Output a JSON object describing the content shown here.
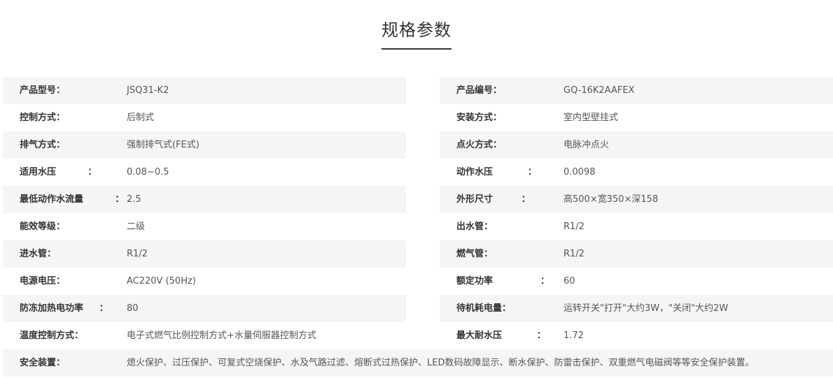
{
  "page": {
    "title": "规格参数"
  },
  "rows": [
    {
      "left": {
        "label": "产品型号：",
        "value": "JSQ31-K2"
      },
      "right": {
        "label": "产品编号：",
        "value": "GQ-16K2AAFEX"
      }
    },
    {
      "left": {
        "label": "控制方式：",
        "value": "后制式"
      },
      "right": {
        "label": "安装方式：",
        "value": "室内型壁挂式"
      }
    },
    {
      "left": {
        "label": "排气方式：",
        "value": "强制排气式(FE式)"
      },
      "right": {
        "label": "点火方式：",
        "value": "电脉冲点火"
      }
    },
    {
      "left": {
        "label": "适用水压          ：",
        "value": "0.08~0.5"
      },
      "right": {
        "label": "动作水压           ：",
        "value": "0.0098"
      }
    },
    {
      "left": {
        "label": "最低动作水流量          ：",
        "value": "2.5"
      },
      "right": {
        "label": "外形尺寸         ：",
        "value": "高500×宽350×深158"
      }
    },
    {
      "left": {
        "label": "能效等级：",
        "value": "二级"
      },
      "right": {
        "label": "出水管：",
        "value": "R1/2"
      }
    },
    {
      "left": {
        "label": "进水管：",
        "value": "R1/2"
      },
      "right": {
        "label": "燃气管：",
        "value": "R1/2"
      }
    },
    {
      "left": {
        "label": "电源电压：",
        "value": "AC220V (50Hz)"
      },
      "right": {
        "label": "额定功率               ：",
        "value": "60"
      }
    },
    {
      "left": {
        "label": "防冻加热电功率     ：",
        "value": "80"
      },
      "right": {
        "label": "待机耗电量：",
        "value": "运转开关\"打开\"大约3W，\"关闭\"大约2W"
      }
    },
    {
      "left": {
        "label": "温度控制方式：",
        "value": "电子式燃气比例控制方式+水量伺服器控制方式"
      },
      "right": {
        "label": "最大耐水压           ：",
        "value": "1.72"
      }
    }
  ],
  "full_row": {
    "label": "安全装置：",
    "value": "熄火保护、过压保护、可复式空烧保护、水及气路过滤、熔断式过热保护、LED数码故障显示、断水保护、防雷击保护、双重燃气电磁阀等等安全保护装置。"
  }
}
